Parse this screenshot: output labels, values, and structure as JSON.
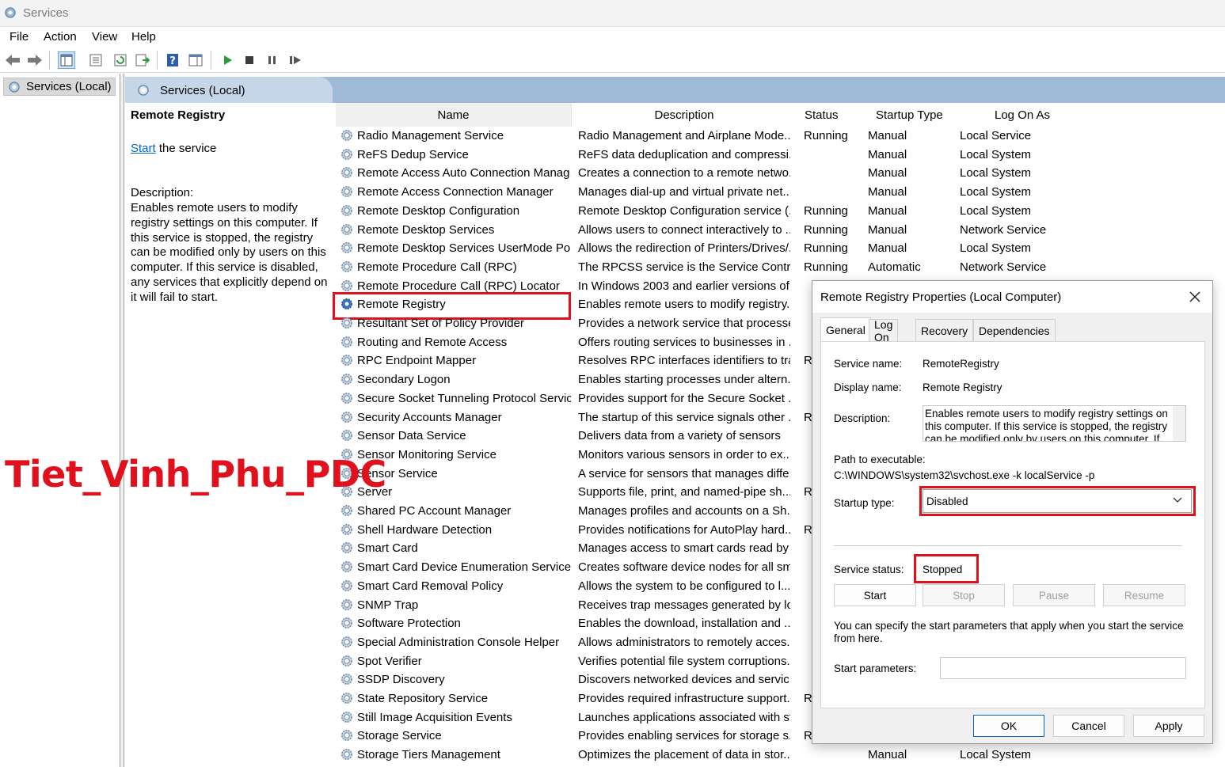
{
  "window": {
    "title": "Services"
  },
  "menu": [
    "File",
    "Action",
    "View",
    "Help"
  ],
  "toolbar": {
    "icons": [
      "back-icon",
      "forward-icon",
      "show-hide-tree-icon",
      "properties-icon",
      "refresh-icon",
      "export-list-icon",
      "help-icon",
      "show-action-pane-icon",
      "start-service-icon",
      "stop-service-icon",
      "pause-service-icon",
      "resume-service-icon"
    ]
  },
  "tree": {
    "root_label": "Services (Local)"
  },
  "main_header": {
    "title": "Services (Local)"
  },
  "description_pane": {
    "service_title": "Remote Registry",
    "start_link": "Start",
    "start_suffix": " the service",
    "description_label": "Description:",
    "description_text": "Enables remote users to modify registry settings on this computer. If this service is stopped, the registry can be modified only by users on this computer. If this service is disabled, any services that explicitly depend on it will fail to start."
  },
  "columns": {
    "name": "Name",
    "description": "Description",
    "status": "Status",
    "startup": "Startup Type",
    "logon": "Log On As"
  },
  "services": [
    {
      "name": "Radio Management Service",
      "desc": "Radio Management and Airplane Mode...",
      "status": "Running",
      "startup": "Manual",
      "logon": "Local Service"
    },
    {
      "name": "ReFS Dedup Service",
      "desc": "ReFS data deduplication and compressi...",
      "status": "",
      "startup": "Manual",
      "logon": "Local System"
    },
    {
      "name": "Remote Access Auto Connection Manag...",
      "desc": "Creates a connection to a remote netwo...",
      "status": "",
      "startup": "Manual",
      "logon": "Local System"
    },
    {
      "name": "Remote Access Connection Manager",
      "desc": "Manages dial-up and virtual private net...",
      "status": "",
      "startup": "Manual",
      "logon": "Local System"
    },
    {
      "name": "Remote Desktop Configuration",
      "desc": "Remote Desktop Configuration service (...",
      "status": "Running",
      "startup": "Manual",
      "logon": "Local System"
    },
    {
      "name": "Remote Desktop Services",
      "desc": "Allows users to connect interactively to ...",
      "status": "Running",
      "startup": "Manual",
      "logon": "Network Service"
    },
    {
      "name": "Remote Desktop Services UserMode Por...",
      "desc": "Allows the redirection of Printers/Drives/...",
      "status": "Running",
      "startup": "Manual",
      "logon": "Local System"
    },
    {
      "name": "Remote Procedure Call (RPC)",
      "desc": "The RPCSS service is the Service Control ...",
      "status": "Running",
      "startup": "Automatic",
      "logon": "Network Service"
    },
    {
      "name": "Remote Procedure Call (RPC) Locator",
      "desc": "In Windows 2003 and earlier versions of...",
      "status": "",
      "startup": "",
      "logon": ""
    },
    {
      "name": "Remote Registry",
      "desc": "Enables remote users to modify registry...",
      "status": "",
      "startup": "",
      "logon": ""
    },
    {
      "name": "Resultant Set of Policy Provider",
      "desc": "Provides a network service that processe...",
      "status": "",
      "startup": "",
      "logon": ""
    },
    {
      "name": "Routing and Remote Access",
      "desc": "Offers routing services to businesses in ...",
      "status": "",
      "startup": "",
      "logon": ""
    },
    {
      "name": "RPC Endpoint Mapper",
      "desc": "Resolves RPC interfaces identifiers to tra...",
      "status": "Ru",
      "startup": "",
      "logon": ""
    },
    {
      "name": "Secondary Logon",
      "desc": "Enables starting processes under altern...",
      "status": "",
      "startup": "",
      "logon": ""
    },
    {
      "name": "Secure Socket Tunneling Protocol Service",
      "desc": "Provides support for the Secure Socket ...",
      "status": "",
      "startup": "",
      "logon": ""
    },
    {
      "name": "Security Accounts Manager",
      "desc": "The startup of this service signals other ...",
      "status": "Ru",
      "startup": "",
      "logon": ""
    },
    {
      "name": "Sensor Data Service",
      "desc": "Delivers data from a variety of sensors",
      "status": "",
      "startup": "",
      "logon": ""
    },
    {
      "name": "Sensor Monitoring Service",
      "desc": "Monitors various sensors in order to ex...",
      "status": "",
      "startup": "",
      "logon": ""
    },
    {
      "name": "Sensor Service",
      "desc": "A service for sensors that manages diffe...",
      "status": "",
      "startup": "",
      "logon": ""
    },
    {
      "name": "Server",
      "desc": "Supports file, print, and named-pipe sh...",
      "status": "Ru",
      "startup": "",
      "logon": ""
    },
    {
      "name": "Shared PC Account Manager",
      "desc": "Manages profiles and accounts on a Sh...",
      "status": "",
      "startup": "",
      "logon": ""
    },
    {
      "name": "Shell Hardware Detection",
      "desc": "Provides notifications for AutoPlay hard...",
      "status": "Ru",
      "startup": "",
      "logon": ""
    },
    {
      "name": "Smart Card",
      "desc": "Manages access to smart cards read by t...",
      "status": "",
      "startup": "",
      "logon": ""
    },
    {
      "name": "Smart Card Device Enumeration Service",
      "desc": "Creates software device nodes for all sm...",
      "status": "",
      "startup": "",
      "logon": ""
    },
    {
      "name": "Smart Card Removal Policy",
      "desc": "Allows the system to be configured to l...",
      "status": "",
      "startup": "",
      "logon": ""
    },
    {
      "name": "SNMP Trap",
      "desc": "Receives trap messages generated by lo...",
      "status": "",
      "startup": "",
      "logon": ""
    },
    {
      "name": "Software Protection",
      "desc": "Enables the download, installation and ...",
      "status": "",
      "startup": "",
      "logon": ""
    },
    {
      "name": "Special Administration Console Helper",
      "desc": "Allows administrators to remotely acces...",
      "status": "",
      "startup": "",
      "logon": ""
    },
    {
      "name": "Spot Verifier",
      "desc": "Verifies potential file system corruptions.",
      "status": "",
      "startup": "",
      "logon": ""
    },
    {
      "name": "SSDP Discovery",
      "desc": "Discovers networked devices and servic...",
      "status": "",
      "startup": "",
      "logon": ""
    },
    {
      "name": "State Repository Service",
      "desc": "Provides required infrastructure support...",
      "status": "Ru",
      "startup": "",
      "logon": ""
    },
    {
      "name": "Still Image Acquisition Events",
      "desc": "Launches applications associated with st...",
      "status": "",
      "startup": "",
      "logon": ""
    },
    {
      "name": "Storage Service",
      "desc": "Provides enabling services for storage s...",
      "status": "Ru",
      "startup": "",
      "logon": ""
    },
    {
      "name": "Storage Tiers Management",
      "desc": "Optimizes the placement of data in stor...",
      "status": "",
      "startup": "Manual",
      "logon": "Local System"
    }
  ],
  "watermark": "Tiet_Vinh_Phu_PDC",
  "dialog": {
    "title": "Remote Registry Properties (Local Computer)",
    "tabs": [
      "General",
      "Log On",
      "Recovery",
      "Dependencies"
    ],
    "service_name_label": "Service name:",
    "service_name": "RemoteRegistry",
    "display_name_label": "Display name:",
    "display_name": "Remote Registry",
    "description_label": "Description:",
    "description": "Enables remote users to modify registry settings on this computer. If this service is stopped, the registry can be modified only by users on this computer. If",
    "path_label": "Path to executable:",
    "path": "C:\\WINDOWS\\system32\\svchost.exe -k localService -p",
    "startup_type_label": "Startup type:",
    "startup_type": "Disabled",
    "service_status_label": "Service status:",
    "service_status": "Stopped",
    "buttons": {
      "start": "Start",
      "stop": "Stop",
      "pause": "Pause",
      "resume": "Resume"
    },
    "hint": "You can specify the start parameters that apply when you start the service from here.",
    "start_params_label": "Start parameters:",
    "footer": {
      "ok": "OK",
      "cancel": "Cancel",
      "apply": "Apply"
    }
  },
  "colors": {
    "highlight_red": "#e0111d",
    "header_blue": "#9fbad6",
    "link_blue": "#0066cc"
  }
}
